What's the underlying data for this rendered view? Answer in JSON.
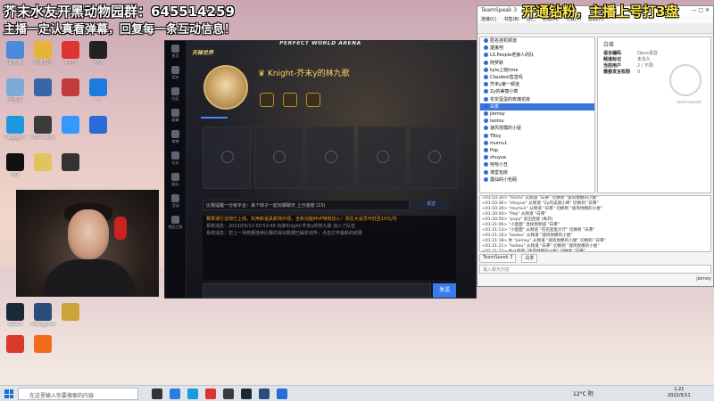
{
  "overlay": {
    "line1": "芥末水友开黑动物园群：645514259",
    "line2": "主播一定认真看弹幕，回复每一条互动信息！",
    "line3": "开通钻粉，主播上号打3盘"
  },
  "desktop": {
    "icons": [
      {
        "label": "此电脑",
        "color": "#4b8bdc"
      },
      {
        "label": "快速访问",
        "color": "#e6b43a"
      },
      {
        "label": "2345",
        "color": "#d33"
      },
      {
        "label": "QQ",
        "color": "#222"
      },
      {
        "label": "回收站",
        "color": "#7fa9d6"
      },
      {
        "label": "",
        "color": "#3a66a8"
      },
      {
        "label": "",
        "color": "#c23b3b"
      },
      {
        "label": "K",
        "color": "#1b7be0"
      },
      {
        "label": "Microsoft Edge",
        "color": "#1d9adf"
      },
      {
        "label": "OBS Studio",
        "color": "#3b3b3b"
      },
      {
        "label": "",
        "color": "#3399ff"
      },
      {
        "label": "",
        "color": "#2b6bd8"
      },
      {
        "label": "QQ",
        "color": "#111"
      },
      {
        "label": "",
        "color": "#e0c45e"
      },
      {
        "label": "",
        "color": "#333"
      },
      {
        "label": "Steam",
        "color": "#1b2838"
      },
      {
        "label": "TeamSpeak 3",
        "color": "#2a4d7a"
      },
      {
        "label": "",
        "color": "#c8a43a"
      },
      {
        "label": "",
        "color": "#d93b2b"
      },
      {
        "label": "",
        "color": "#f26b1d"
      }
    ]
  },
  "game": {
    "title": "PERFECT WORLD ARENA",
    "brand": "天梯世界",
    "room_name": "Knight-芥末y的林九歌",
    "nav_labels": [
      "首页",
      "竞技",
      "社区",
      "赛事",
      "商城",
      "社交",
      "组队",
      "活动",
      "物品工具"
    ],
    "chat_hint": "比赛提醒一分级平台：来个妹子一起玩聊聊天 上分速度",
    "chat_count": "(15)",
    "chat_send": "发送",
    "chat_lines": [
      {
        "text": "赛季通行证现已上线，实用新道具新饰外观，全新功能MVP特效加入！现在大会员可低至10元/月",
        "style": "hl"
      },
      {
        "text": "系统消息：2022/05/11 00:53:46 玩家Knight-芥末y的林九歌 加入了队伍",
        "style": "sys"
      },
      {
        "text": "系统消息：您上一场竞赛连续比赛的得出数据已解析完毕，点击打开最新的结果",
        "style": "sys"
      }
    ],
    "send_label": "发送"
  },
  "teamspeak": {
    "title": "TeamSpeak 3",
    "menu": [
      "连接(C)",
      "书签(B)",
      "自己",
      "权限(M)",
      "工具(T)",
      "帮助(H)"
    ],
    "tree": [
      {
        "name": "匿名挂机频道",
        "sel": false
      },
      {
        "name": "烟鬼吧",
        "sel": false
      },
      {
        "name": "LS.People老狼人的队",
        "sel": false
      },
      {
        "name": "阿罗斯",
        "sel": false
      },
      {
        "name": "kyle上班time",
        "sel": false
      },
      {
        "name": "Claudeol蛮蛮吗",
        "sel": false
      },
      {
        "name": "芥末y第一频道",
        "sel": false
      },
      {
        "name": "Zy的美丽小窝",
        "sel": false
      },
      {
        "name": "花花蛋蛋的玫瑰花房",
        "sel": false
      },
      {
        "name": "白茶",
        "sel": true
      },
      {
        "name": "jiemoy",
        "sel": false
      },
      {
        "name": "laotou",
        "sel": false
      },
      {
        "name": "速风悦模的小屋",
        "sel": false
      },
      {
        "name": "TBoy",
        "sel": false
      },
      {
        "name": "mumu1",
        "sel": false
      },
      {
        "name": "Pop",
        "sel": false
      },
      {
        "name": "zhuyue",
        "sel": false
      },
      {
        "name": "哈哈小丑",
        "sel": false
      },
      {
        "name": "课堂包房",
        "sel": false
      },
      {
        "name": "露仙的小包厢",
        "sel": false
      }
    ],
    "side_header": "白茶",
    "side_rows": [
      {
        "k": "语言编码",
        "v": "Opus语音"
      },
      {
        "k": "频道标记",
        "v": "未永久"
      },
      {
        "k": "当前用户",
        "v": "2 / 不限"
      },
      {
        "k": "需要发言权限",
        "v": "0"
      }
    ],
    "logo_text": "teamspeak",
    "log": [
      "<01:10:30> \"momi\" 从频道 \"白茶\" 切换到 \"速风悦模的小屋\"",
      "<01:10:36> \"zhuyue\" 从频道 \"Zy的美丽小窝\" 切换到 \"白茶\"",
      "<01:10:39> \"mumu1\" 从频道 \"白茶\" 切换到 \"速风悦模的小屋\"",
      "<01:20:44> \"Pop\" 从频道 \"白茶\"",
      "<01:20:50> \"pvpy\" 退出连接 (离开)",
      "<01:21:06> \"小蛋面\" 连接到频道 \"白茶\"",
      "<01:21:13> \"小蛋面\" 从频道 \"花花蛋蛋大厅\" 切换到 \"白茶\"",
      "<01:21:16> \"laotou\" 从频道 \"速风悦模的小屋\"",
      "<01:21:18> 你 \"jiemoy\" 从频道 \"速风悦模的小屋\" 切换到 \"白茶\"",
      "<01:21:21> \"laotou\" 从频道 \"白茶\" 切换到 \"速风悦模的小屋\"",
      "<01:21:23> 你从频道 \"速风悦模的小屋\" 切换到 \"白茶\"",
      "<01:21:26> \"skk999\" 从频道 \"速风悦模的小屋\" 切换到 \"芥末y的老友\""
    ],
    "tabs": [
      "TeamSpeak 3",
      "白茶"
    ],
    "input_placeholder": "输入聊天内容",
    "status_user": "jiemoy"
  },
  "taskbar": {
    "search_placeholder": "在这里输入你要搜索的内容",
    "weather": "12°C 阴",
    "time": "1:21",
    "date": "2022/5/11"
  }
}
